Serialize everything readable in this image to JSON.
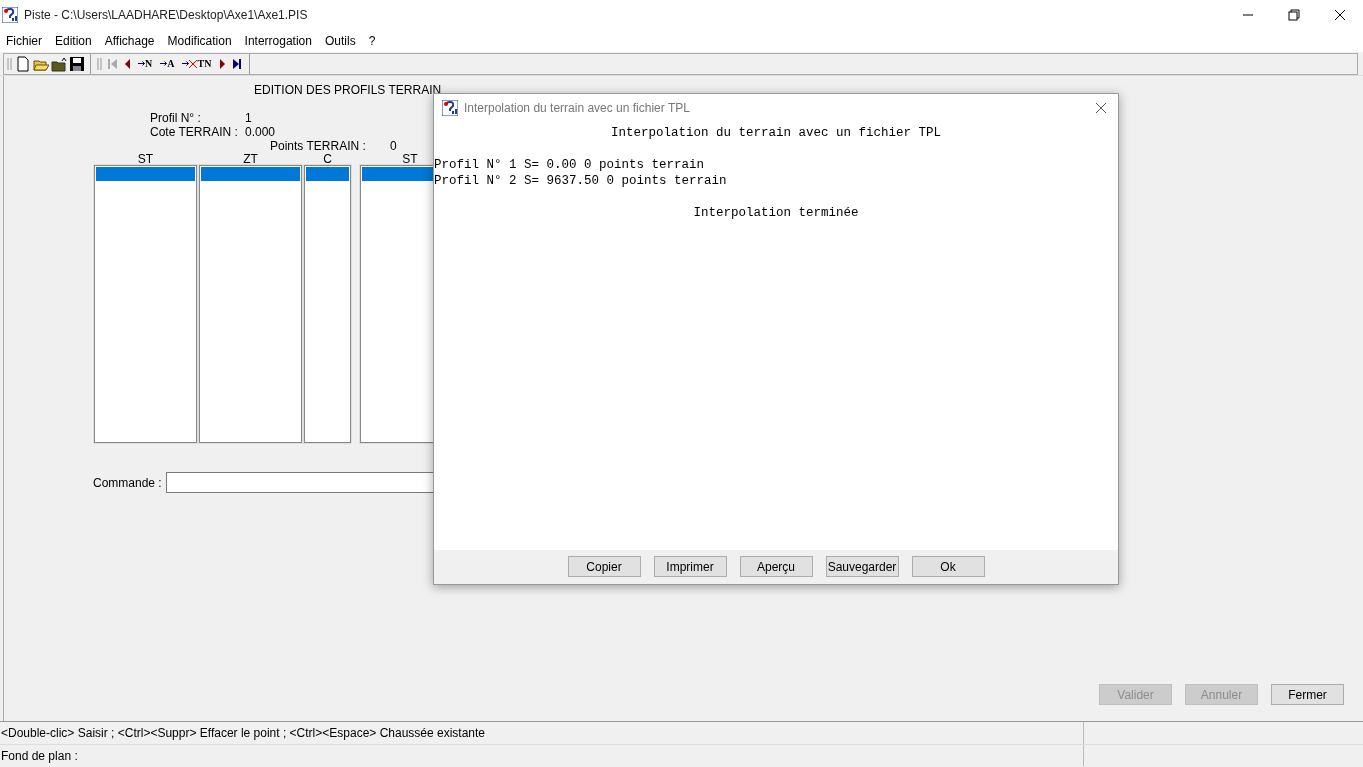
{
  "window": {
    "title": "Piste - C:\\Users\\LAADHARE\\Desktop\\Axe1\\Axe1.PIS"
  },
  "menu": [
    "Fichier",
    "Edition",
    "Affichage",
    "Modification",
    "Interrogation",
    "Outils",
    "?"
  ],
  "toolbar": [
    {
      "kind": "grip"
    },
    {
      "kind": "new"
    },
    {
      "kind": "open"
    },
    {
      "kind": "folder-up"
    },
    {
      "kind": "save"
    },
    {
      "kind": "sep"
    },
    {
      "kind": "grip"
    },
    {
      "kind": "first",
      "disabled": true
    },
    {
      "kind": "prev",
      "disabled": false
    },
    {
      "kind": "insert",
      "label": "N"
    },
    {
      "kind": "insert",
      "label": "A"
    },
    {
      "kind": "delete",
      "label": "TN"
    },
    {
      "kind": "next",
      "disabled": false
    },
    {
      "kind": "last",
      "disabled": false
    },
    {
      "kind": "sep"
    }
  ],
  "form": {
    "title": "EDITION DES PROFILS TERRAIN",
    "fields": [
      {
        "label": "Profil N° :",
        "value": "1"
      },
      {
        "label": "Cote TERRAIN :",
        "value": "0.000"
      }
    ],
    "points": {
      "label": "Points TERRAIN :",
      "value": "0"
    },
    "lists": [
      {
        "header": "ST",
        "rows": [
          {
            "selected": true
          }
        ]
      },
      {
        "header": "ZT",
        "rows": [
          {
            "selected": true
          }
        ]
      },
      {
        "header": "C",
        "rows": [
          {
            "selected": true
          }
        ]
      },
      {
        "header": "ST",
        "rows": [
          {
            "selected": true
          }
        ]
      }
    ],
    "command": {
      "label": "Commande :"
    },
    "buttons": [
      {
        "label": "Valider",
        "disabled": true
      },
      {
        "label": "Annuler",
        "disabled": true
      },
      {
        "label": "Fermer",
        "disabled": false
      }
    ]
  },
  "dialog": {
    "title": "Interpolation du terrain avec un fichier TPL",
    "heading": "Interpolation du terrain avec un fichier TPL",
    "lines": [
      "Profil N° 1 S= 0.00 0 points terrain",
      "Profil N° 2 S= 9637.50 0 points terrain"
    ],
    "footer": "Interpolation terminée",
    "buttons": [
      "Copier",
      "Imprimer",
      "Aperçu",
      "Sauvegarder",
      "Ok"
    ]
  },
  "status_bar": [
    "<Double-clic> Saisir ; <Ctrl><Suppr> Effacer le point ; <Ctrl><Espace> Chaussée existante",
    "Fond de plan :"
  ]
}
